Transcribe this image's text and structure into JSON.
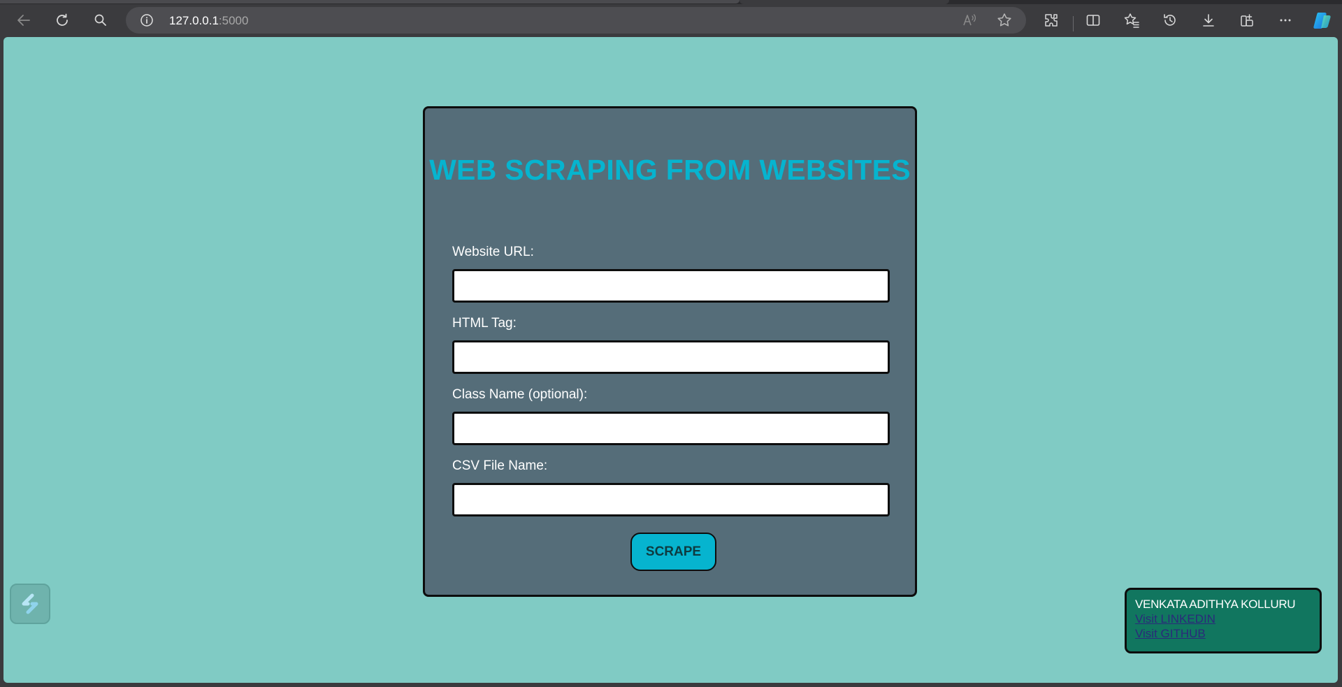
{
  "browser": {
    "url_host": "127.0.0.1",
    "url_port": ":5000",
    "read_aloud_glyph": "Aʾ"
  },
  "page": {
    "title": "WEB SCRAPING FROM WEBSITES",
    "fields": [
      {
        "label": "Website URL:",
        "value": ""
      },
      {
        "label": "HTML Tag:",
        "value": ""
      },
      {
        "label": "Class Name (optional):",
        "value": ""
      },
      {
        "label": "CSV File Name:",
        "value": ""
      }
    ],
    "submit_label": "SCRAPE",
    "author": {
      "name": "VENKATA ADITHYA KOLLURU",
      "linkedin_label": "Visit LINKEDIN",
      "github_label": "Visit GITHUB"
    }
  },
  "colors": {
    "page_background": "#80cbc4",
    "card_background": "#556d79",
    "title_color": "#06b4cf",
    "button_color": "#06b4cf",
    "author_box_background": "#11765f"
  },
  "icons": {
    "toolbar": [
      "back-icon",
      "refresh-icon",
      "search-icon",
      "site-info-icon",
      "read-aloud-icon",
      "favorite-star-icon",
      "extensions-icon",
      "split-screen-icon",
      "favorites-icon",
      "history-icon",
      "downloads-icon",
      "collections-icon",
      "more-icon",
      "copilot-icon"
    ],
    "widget": "floating-s-widget-icon"
  }
}
